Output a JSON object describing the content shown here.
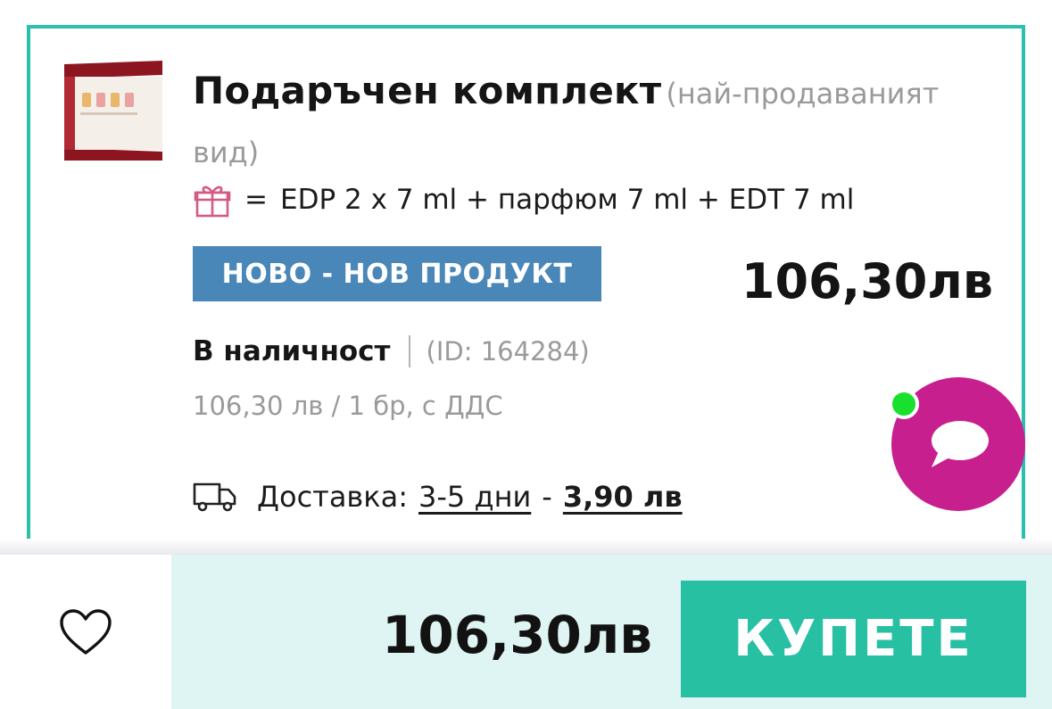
{
  "product": {
    "title": "Подаръчен комплект",
    "title_note": "(най-продаваният вид)",
    "gift_equals": "=",
    "gift_contents": "EDP 2 x 7 ml + парфюм 7 ml + EDT 7 ml",
    "badge": "НОВО - НОВ ПРОДУКТ",
    "price": "106,30лв",
    "stock": "В наличност",
    "id_text": "(ID: 164284)",
    "unit_price": "106,30 лв / 1 бр, с ДДС",
    "delivery_label": "Доставка:",
    "delivery_time": "3-5 дни",
    "delivery_dash": "-",
    "delivery_fee": "3,90 лв"
  },
  "bottom_bar": {
    "price": "106,30лв",
    "buy_label": "КУПЕТЕ"
  },
  "icons": {
    "gift": "gift-icon",
    "truck": "truck-icon",
    "heart": "heart-icon",
    "chat": "chat-bubble-icon"
  },
  "colors": {
    "card_border": "#2bbfae",
    "badge": "#4a87b9",
    "chat_fab": "#c81f8f",
    "online_dot": "#18e02c",
    "buy_button": "#27c0a3",
    "bar_background": "#dff5f3"
  }
}
